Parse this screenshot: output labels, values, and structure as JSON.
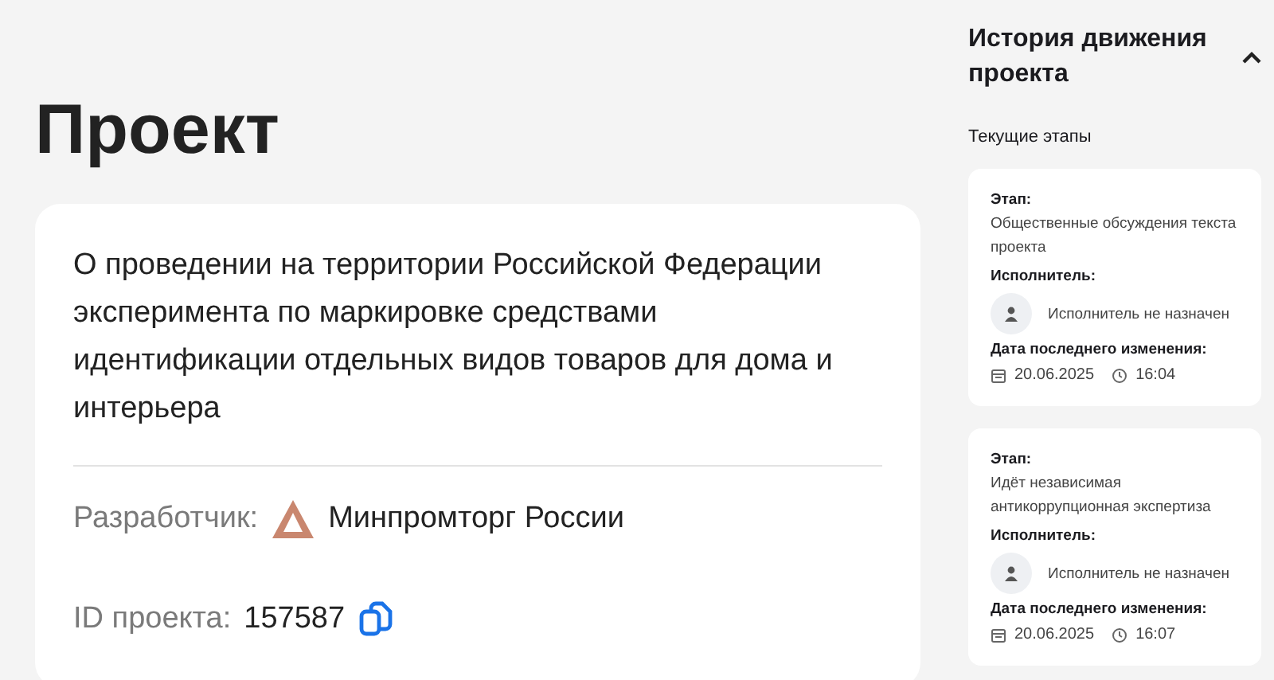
{
  "page_title": "Проект",
  "project": {
    "description": "О проведении на территории Российской Федерации эксперимента по маркировке средствами идентификации отдельных видов товаров для дома и интерьера",
    "developer_label": "Разработчик:",
    "developer": "Минпромторг России",
    "id_label": "ID проекта:",
    "id": "157587"
  },
  "history": {
    "title": "История движения проекта",
    "expanded": true,
    "subtitle": "Текущие этапы",
    "stages": [
      {
        "stage_label": "Этап:",
        "stage": "Общественные обсуждения текста проекта",
        "assignee_label": "Исполнитель:",
        "assignee": "Исполнитель не назначен",
        "date_label": "Дата последнего изменения:",
        "date": "20.06.2025",
        "time": "16:04"
      },
      {
        "stage_label": "Этап:",
        "stage": "Идёт независимая антикоррупционная экспертиза",
        "assignee_label": "Исполнитель:",
        "assignee": "Исполнитель не назначен",
        "date_label": "Дата последнего изменения:",
        "date": "20.06.2025",
        "time": "16:07"
      }
    ]
  }
}
